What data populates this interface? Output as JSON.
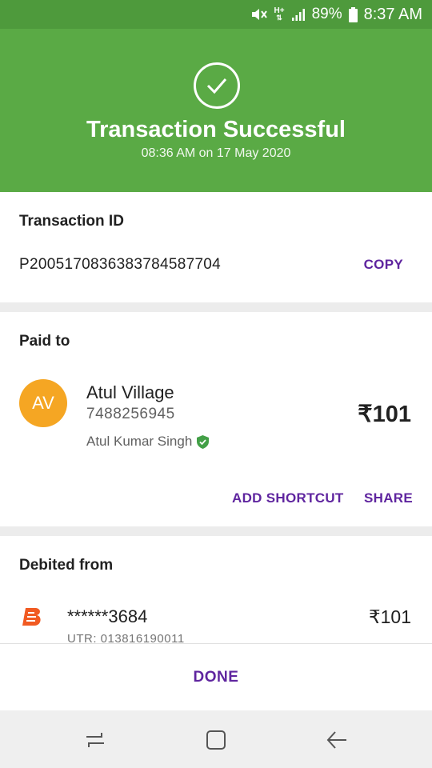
{
  "status_bar": {
    "battery": "89%",
    "time": "8:37 AM",
    "network_type": "H+",
    "icons": [
      "mute-icon",
      "network-type-icon",
      "signal-icon",
      "battery-icon"
    ]
  },
  "header": {
    "title": "Transaction Successful",
    "timestamp": "08:36 AM on 17 May 2020",
    "icon": "check-circle-icon",
    "color": "#5aaa45"
  },
  "transaction": {
    "label": "Transaction ID",
    "id": "P2005170836383784587704",
    "copy_label": "COPY"
  },
  "paid_to": {
    "label": "Paid to",
    "avatar_initials": "AV",
    "avatar_color": "#f5a623",
    "name": "Atul Village",
    "phone": "7488256945",
    "holder_name": "Atul Kumar Singh",
    "verified_icon": "verified-shield-icon",
    "amount": "₹101",
    "add_shortcut_label": "ADD SHORTCUT",
    "share_label": "SHARE"
  },
  "debited_from": {
    "label": "Debited from",
    "bank_icon": "bank-of-baroda-logo-icon",
    "account": "******3684",
    "amount": "₹101",
    "utr": "UTR: 013816190011"
  },
  "done_label": "DONE",
  "accent_color": "#5f259f",
  "nav_bar": {
    "icons": [
      "recent-apps-icon",
      "home-icon",
      "back-icon"
    ]
  }
}
